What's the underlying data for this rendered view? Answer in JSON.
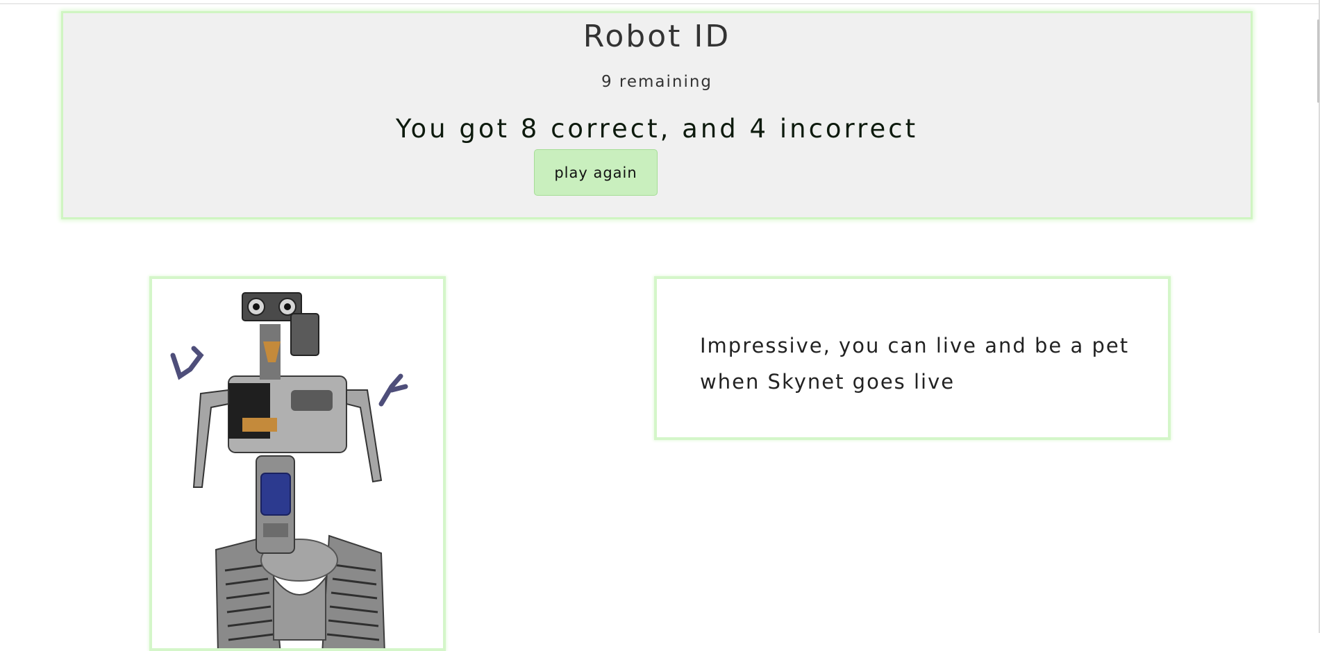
{
  "header": {
    "title": "Robot ID",
    "remaining": "9 remaining",
    "score_text": "You got 8 correct, and 4 incorrect",
    "play_again_label": "play again"
  },
  "result": {
    "image_subject": "robot",
    "message": "Impressive, you can live and be a pet when Skynet goes live"
  },
  "colors": {
    "panel_bg": "#f0f0f0",
    "panel_border": "#cff5c2",
    "button_bg": "#c9efbe"
  }
}
